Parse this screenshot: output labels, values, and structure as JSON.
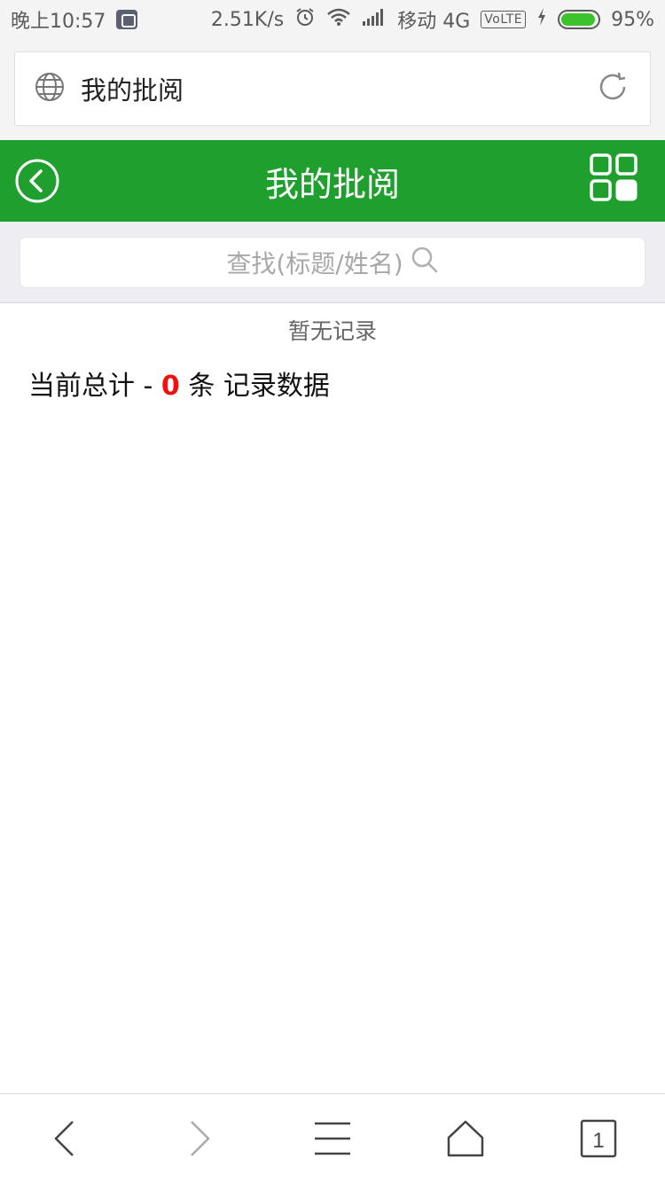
{
  "status_bar": {
    "time": "晚上10:57",
    "network_speed": "2.51K/s",
    "carrier": "移动 4G",
    "volte": "VoLTE",
    "battery_percent": "95%",
    "battery_level": 0.95,
    "icons": [
      "app-icon",
      "alarm-icon",
      "wifi-icon",
      "signal-icon",
      "charging-icon",
      "battery-icon"
    ]
  },
  "address_bar": {
    "title": "我的批阅",
    "icons": [
      "globe-icon",
      "reload-icon"
    ]
  },
  "header": {
    "title": "我的批阅",
    "background": "#1e9f2e",
    "icons": [
      "back-circle-icon",
      "grid-menu-icon"
    ]
  },
  "search": {
    "placeholder": "查找(标题/姓名)",
    "icon": "search-icon"
  },
  "content": {
    "empty_message": "暂无记录",
    "total_prefix": "当前总计 - ",
    "total_count": "0",
    "total_suffix": " 条 记录数据",
    "count_color": "#f01010"
  },
  "bottom_toolbar": {
    "tab_count": "1",
    "icons": [
      "back-arrow-icon",
      "forward-arrow-icon",
      "menu-icon",
      "home-icon",
      "tabs-icon"
    ]
  }
}
